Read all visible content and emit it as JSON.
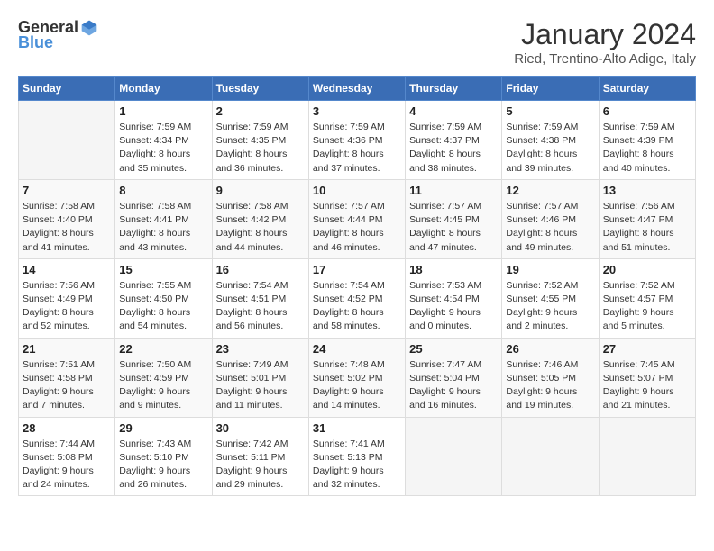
{
  "logo": {
    "general": "General",
    "blue": "Blue"
  },
  "title": "January 2024",
  "subtitle": "Ried, Trentino-Alto Adige, Italy",
  "weekdays": [
    "Sunday",
    "Monday",
    "Tuesday",
    "Wednesday",
    "Thursday",
    "Friday",
    "Saturday"
  ],
  "weeks": [
    [
      {
        "day": "",
        "info": ""
      },
      {
        "day": "1",
        "info": "Sunrise: 7:59 AM\nSunset: 4:34 PM\nDaylight: 8 hours\nand 35 minutes."
      },
      {
        "day": "2",
        "info": "Sunrise: 7:59 AM\nSunset: 4:35 PM\nDaylight: 8 hours\nand 36 minutes."
      },
      {
        "day": "3",
        "info": "Sunrise: 7:59 AM\nSunset: 4:36 PM\nDaylight: 8 hours\nand 37 minutes."
      },
      {
        "day": "4",
        "info": "Sunrise: 7:59 AM\nSunset: 4:37 PM\nDaylight: 8 hours\nand 38 minutes."
      },
      {
        "day": "5",
        "info": "Sunrise: 7:59 AM\nSunset: 4:38 PM\nDaylight: 8 hours\nand 39 minutes."
      },
      {
        "day": "6",
        "info": "Sunrise: 7:59 AM\nSunset: 4:39 PM\nDaylight: 8 hours\nand 40 minutes."
      }
    ],
    [
      {
        "day": "7",
        "info": "Sunrise: 7:58 AM\nSunset: 4:40 PM\nDaylight: 8 hours\nand 41 minutes."
      },
      {
        "day": "8",
        "info": "Sunrise: 7:58 AM\nSunset: 4:41 PM\nDaylight: 8 hours\nand 43 minutes."
      },
      {
        "day": "9",
        "info": "Sunrise: 7:58 AM\nSunset: 4:42 PM\nDaylight: 8 hours\nand 44 minutes."
      },
      {
        "day": "10",
        "info": "Sunrise: 7:57 AM\nSunset: 4:44 PM\nDaylight: 8 hours\nand 46 minutes."
      },
      {
        "day": "11",
        "info": "Sunrise: 7:57 AM\nSunset: 4:45 PM\nDaylight: 8 hours\nand 47 minutes."
      },
      {
        "day": "12",
        "info": "Sunrise: 7:57 AM\nSunset: 4:46 PM\nDaylight: 8 hours\nand 49 minutes."
      },
      {
        "day": "13",
        "info": "Sunrise: 7:56 AM\nSunset: 4:47 PM\nDaylight: 8 hours\nand 51 minutes."
      }
    ],
    [
      {
        "day": "14",
        "info": "Sunrise: 7:56 AM\nSunset: 4:49 PM\nDaylight: 8 hours\nand 52 minutes."
      },
      {
        "day": "15",
        "info": "Sunrise: 7:55 AM\nSunset: 4:50 PM\nDaylight: 8 hours\nand 54 minutes."
      },
      {
        "day": "16",
        "info": "Sunrise: 7:54 AM\nSunset: 4:51 PM\nDaylight: 8 hours\nand 56 minutes."
      },
      {
        "day": "17",
        "info": "Sunrise: 7:54 AM\nSunset: 4:52 PM\nDaylight: 8 hours\nand 58 minutes."
      },
      {
        "day": "18",
        "info": "Sunrise: 7:53 AM\nSunset: 4:54 PM\nDaylight: 9 hours\nand 0 minutes."
      },
      {
        "day": "19",
        "info": "Sunrise: 7:52 AM\nSunset: 4:55 PM\nDaylight: 9 hours\nand 2 minutes."
      },
      {
        "day": "20",
        "info": "Sunrise: 7:52 AM\nSunset: 4:57 PM\nDaylight: 9 hours\nand 5 minutes."
      }
    ],
    [
      {
        "day": "21",
        "info": "Sunrise: 7:51 AM\nSunset: 4:58 PM\nDaylight: 9 hours\nand 7 minutes."
      },
      {
        "day": "22",
        "info": "Sunrise: 7:50 AM\nSunset: 4:59 PM\nDaylight: 9 hours\nand 9 minutes."
      },
      {
        "day": "23",
        "info": "Sunrise: 7:49 AM\nSunset: 5:01 PM\nDaylight: 9 hours\nand 11 minutes."
      },
      {
        "day": "24",
        "info": "Sunrise: 7:48 AM\nSunset: 5:02 PM\nDaylight: 9 hours\nand 14 minutes."
      },
      {
        "day": "25",
        "info": "Sunrise: 7:47 AM\nSunset: 5:04 PM\nDaylight: 9 hours\nand 16 minutes."
      },
      {
        "day": "26",
        "info": "Sunrise: 7:46 AM\nSunset: 5:05 PM\nDaylight: 9 hours\nand 19 minutes."
      },
      {
        "day": "27",
        "info": "Sunrise: 7:45 AM\nSunset: 5:07 PM\nDaylight: 9 hours\nand 21 minutes."
      }
    ],
    [
      {
        "day": "28",
        "info": "Sunrise: 7:44 AM\nSunset: 5:08 PM\nDaylight: 9 hours\nand 24 minutes."
      },
      {
        "day": "29",
        "info": "Sunrise: 7:43 AM\nSunset: 5:10 PM\nDaylight: 9 hours\nand 26 minutes."
      },
      {
        "day": "30",
        "info": "Sunrise: 7:42 AM\nSunset: 5:11 PM\nDaylight: 9 hours\nand 29 minutes."
      },
      {
        "day": "31",
        "info": "Sunrise: 7:41 AM\nSunset: 5:13 PM\nDaylight: 9 hours\nand 32 minutes."
      },
      {
        "day": "",
        "info": ""
      },
      {
        "day": "",
        "info": ""
      },
      {
        "day": "",
        "info": ""
      }
    ]
  ]
}
